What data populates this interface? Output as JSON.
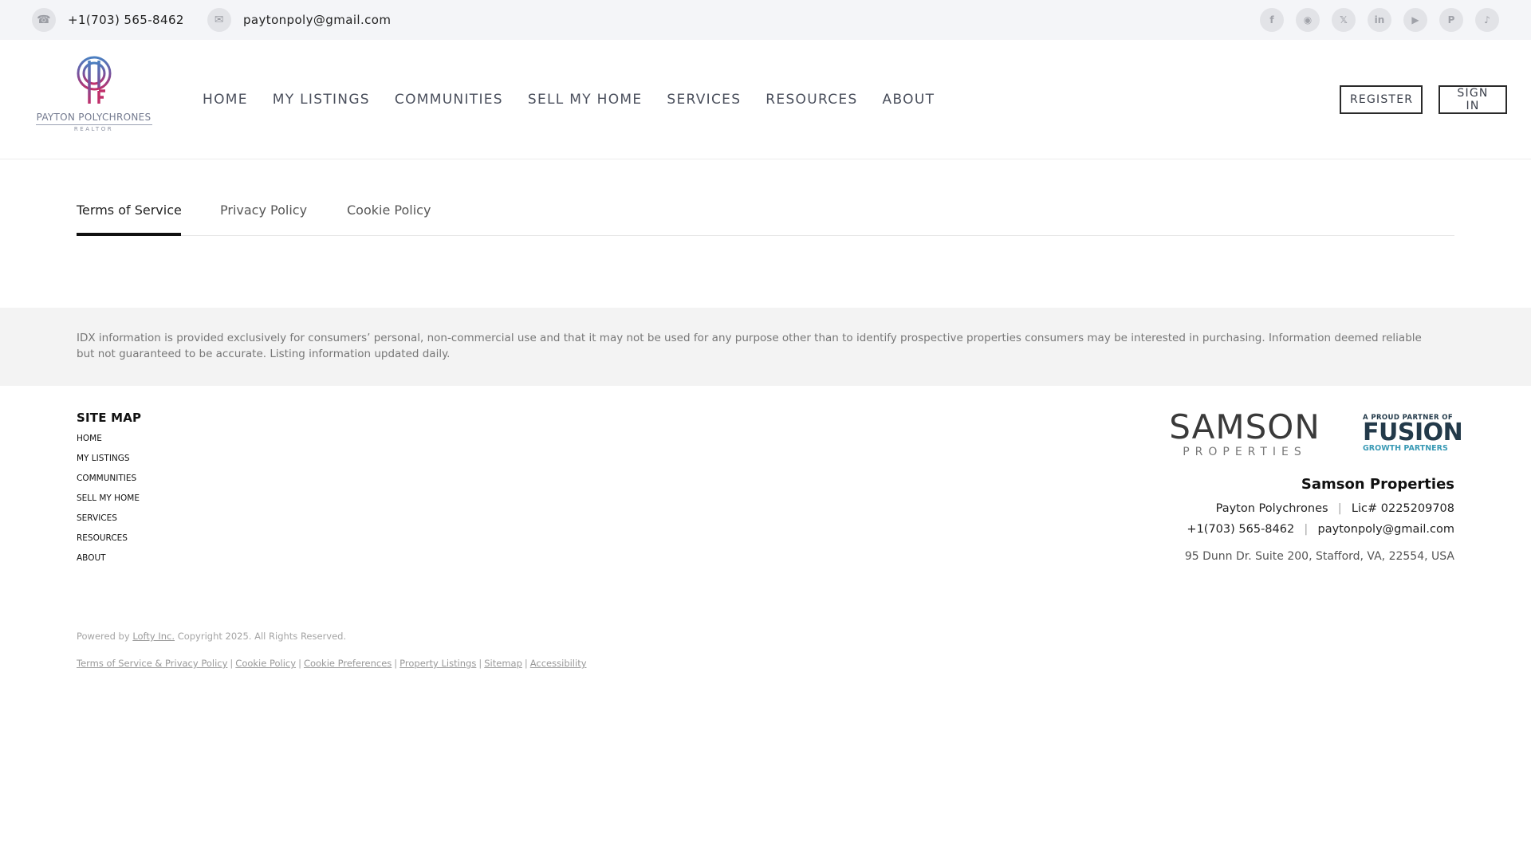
{
  "topbar": {
    "phone": "+1(703) 565-8462",
    "email": "paytonpoly@gmail.com",
    "icons": {
      "phone": "phone-icon",
      "email": "email-icon",
      "socials": [
        "facebook-icon",
        "instagram-icon",
        "twitter-icon",
        "linkedin-icon",
        "youtube-icon",
        "pinterest-icon",
        "tiktok-icon"
      ]
    }
  },
  "header": {
    "logo": {
      "name": "PAYTON POLYCHRONES",
      "sub": "REALTOR"
    },
    "nav": [
      "HOME",
      "MY LISTINGS",
      "COMMUNITIES",
      "SELL MY HOME",
      "SERVICES",
      "RESOURCES",
      "ABOUT"
    ],
    "register": "REGISTER",
    "signin": "SIGN IN"
  },
  "tabs": {
    "terms": "Terms of Service",
    "privacy": "Privacy Policy",
    "cookie": "Cookie Policy",
    "active": "terms"
  },
  "idx": {
    "text": "IDX information is provided exclusively for consumers’ personal, non-commercial use and that it may not be used for any purpose other than to identify prospective properties consumers may be interested in purchasing. Information deemed reliable but not guaranteed to be accurate. Listing information updated daily."
  },
  "footer": {
    "sitemap_title": "SITE MAP",
    "sitemap": [
      "HOME",
      "MY LISTINGS",
      "COMMUNITIES",
      "SELL MY HOME",
      "SERVICES",
      "RESOURCES",
      "ABOUT"
    ],
    "samson": {
      "main": "SAMSON",
      "sub": "PROPERTIES"
    },
    "fusion": {
      "top": "A PROUD PARTNER OF",
      "main": "FUSION",
      "sub": "GROWTH PARTNERS"
    },
    "brand_name": "Samson Properties",
    "agent": "Payton Polychrones",
    "license": "Lic# 0225209708",
    "phone": "+1(703) 565-8462",
    "email": "paytonpoly@gmail.com",
    "address": "95 Dunn Dr. Suite 200, Stafford, VA, 22554, USA",
    "powered_prefix": "Powered by",
    "powered_link": "Lofty Inc.",
    "copyright": "Copyright 2025. All Rights Reserved.",
    "legal_links": [
      "Terms of Service & Privacy Policy",
      "Cookie Policy",
      "Cookie Preferences",
      "Property Listings",
      "Sitemap",
      "Accessibility"
    ]
  },
  "colors": {
    "topbar_bg": "#f4f5f8",
    "nav_text": "#4a4f5c",
    "logo_blue": "#4a7fc1",
    "logo_magenta": "#c0306b",
    "idx_bg": "#f3f3f3",
    "fusion_blue": "#3a9ab5"
  }
}
